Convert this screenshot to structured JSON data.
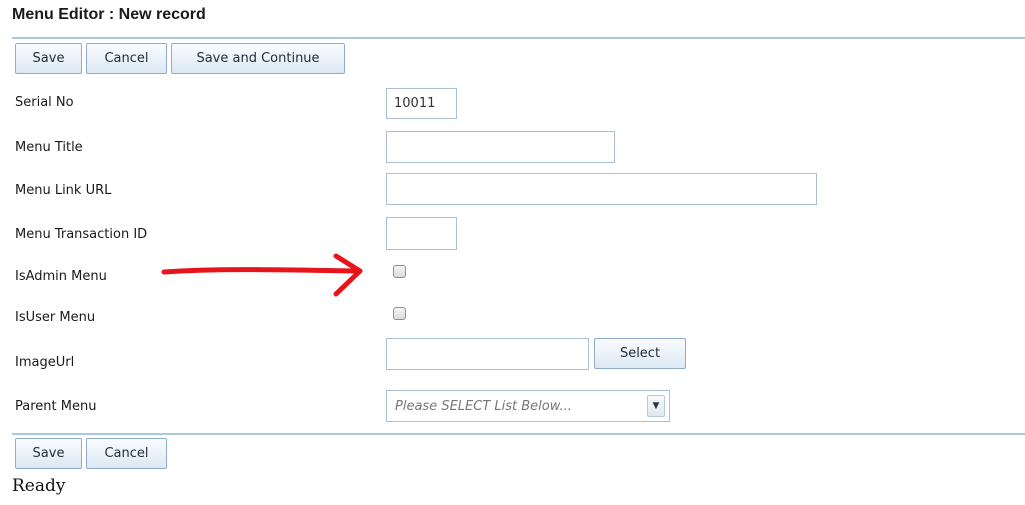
{
  "header": {
    "title": "Menu Editor : New record"
  },
  "toolbar_top": {
    "save_label": "Save",
    "cancel_label": "Cancel",
    "save_continue_label": "Save and Continue"
  },
  "form": {
    "serial_no": {
      "label": "Serial No",
      "value": "10011"
    },
    "menu_title": {
      "label": "Menu Title",
      "value": ""
    },
    "menu_link_url": {
      "label": "Menu Link URL",
      "value": ""
    },
    "menu_transaction_id": {
      "label": "Menu Transaction ID",
      "value": ""
    },
    "is_admin_menu": {
      "label": "IsAdmin Menu",
      "checked": false
    },
    "is_user_menu": {
      "label": "IsUser Menu",
      "checked": false
    },
    "image_url": {
      "label": "ImageUrl",
      "value": "",
      "select_label": "Select"
    },
    "parent_menu": {
      "label": "Parent Menu",
      "placeholder": "Please SELECT List Below..."
    }
  },
  "toolbar_bottom": {
    "save_label": "Save",
    "cancel_label": "Cancel"
  },
  "status": {
    "text": "Ready"
  },
  "colors": {
    "accent_rule": "#a9c9da",
    "button_border": "#8eaccc",
    "annotation_arrow": "#e8141b"
  }
}
